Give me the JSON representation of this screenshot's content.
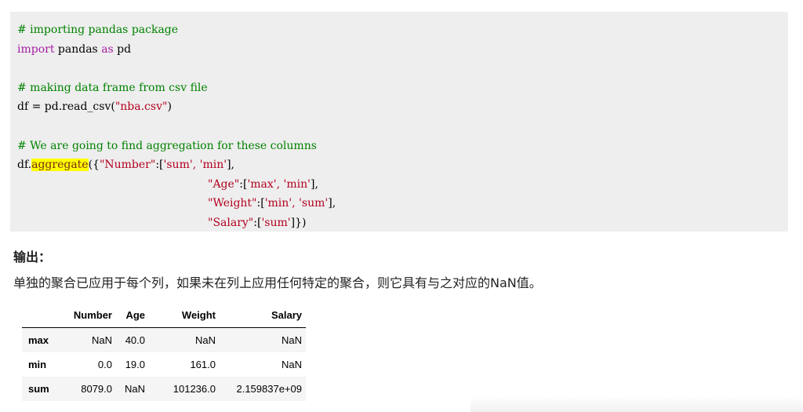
{
  "code": {
    "comment1": "# importing pandas package",
    "import_kw": "import",
    "import_mod": " pandas ",
    "as_kw": "as",
    "import_alias": " pd",
    "comment2": "# making data frame from csv file",
    "read_prefix": "df = pd.read_csv(",
    "read_arg": "\"nba.csv\"",
    "read_suffix": ")",
    "comment3": "# We are going to find aggregation for these columns",
    "agg_prefix": "df.",
    "agg_method": "aggregate",
    "agg_open": "({",
    "agg_line1_key": "\"Number\"",
    "agg_line1_sep": ":[",
    "agg_line1_vals": "'sum', 'min'",
    "agg_line1_end": "],",
    "agg_line2_key": "\"Age\"",
    "agg_line2_sep": ":[",
    "agg_line2_vals": "'max', 'min'",
    "agg_line2_end": "],",
    "agg_line3_key": "\"Weight\"",
    "agg_line3_sep": ":[",
    "agg_line3_vals": "'min', 'sum'",
    "agg_line3_end": "],",
    "agg_line4_key": "\"Salary\"",
    "agg_line4_sep": ":[",
    "agg_line4_vals": "'sum'",
    "agg_line4_end": "]})"
  },
  "output": {
    "heading": "输出：",
    "description": "单独的聚合已应用于每个列，如果未在列上应用任何特定的聚合，则它具有与之对应的NaN值。"
  },
  "table": {
    "headers": [
      "",
      "Number",
      "Age",
      "Weight",
      "Salary"
    ],
    "rows": [
      {
        "index": "max",
        "number": "NaN",
        "age": "40.0",
        "weight": "NaN",
        "salary": "NaN"
      },
      {
        "index": "min",
        "number": "0.0",
        "age": "19.0",
        "weight": "161.0",
        "salary": "NaN"
      },
      {
        "index": "sum",
        "number": "8079.0",
        "age": "NaN",
        "weight": "101236.0",
        "salary": "2.159837e+09"
      }
    ]
  },
  "colors": {
    "code_bg": "#eeeeee",
    "comment": "#008200",
    "keyword": "#a31ea3",
    "string": "#b3001e",
    "highlight": "#ffff00"
  }
}
